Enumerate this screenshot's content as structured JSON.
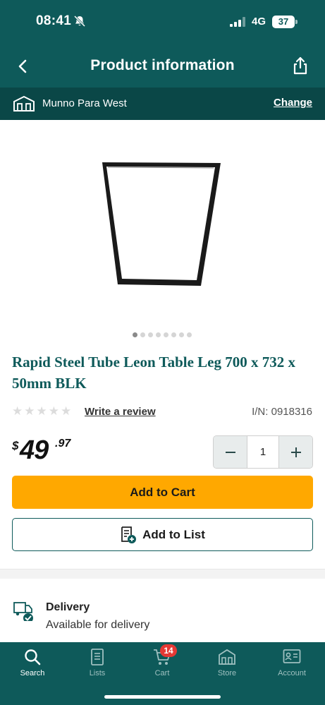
{
  "status_bar": {
    "time": "08:41",
    "network": "4G",
    "battery": "37"
  },
  "header": {
    "title": "Product information"
  },
  "store": {
    "name": "Munno Para West",
    "change_label": "Change"
  },
  "product": {
    "title": "Rapid Steel Tube Leon Table Leg 700 x 732 x 50mm BLK",
    "image_dots": 8,
    "active_image_index": 0,
    "rating_stars": 0,
    "write_review_label": "Write a review",
    "item_number": "I/N: 0918316",
    "price": {
      "symbol": "$",
      "dollars": "49",
      "cents": ".97"
    },
    "quantity": "1",
    "add_to_cart_label": "Add to Cart",
    "add_to_list_label": "Add to List"
  },
  "delivery": {
    "title": "Delivery",
    "status": "Available for delivery"
  },
  "nav": {
    "items": [
      {
        "label": "Search",
        "icon": "search-icon",
        "active": true
      },
      {
        "label": "Lists",
        "icon": "list-icon",
        "active": false
      },
      {
        "label": "Cart",
        "icon": "cart-icon",
        "active": false
      },
      {
        "label": "Store",
        "icon": "store-icon",
        "active": false
      },
      {
        "label": "Account",
        "icon": "account-icon",
        "active": false
      }
    ],
    "cart_badge": "14"
  },
  "colors": {
    "brand": "#0e5a5a",
    "accent": "#ffa800",
    "badge": "#e53935"
  }
}
